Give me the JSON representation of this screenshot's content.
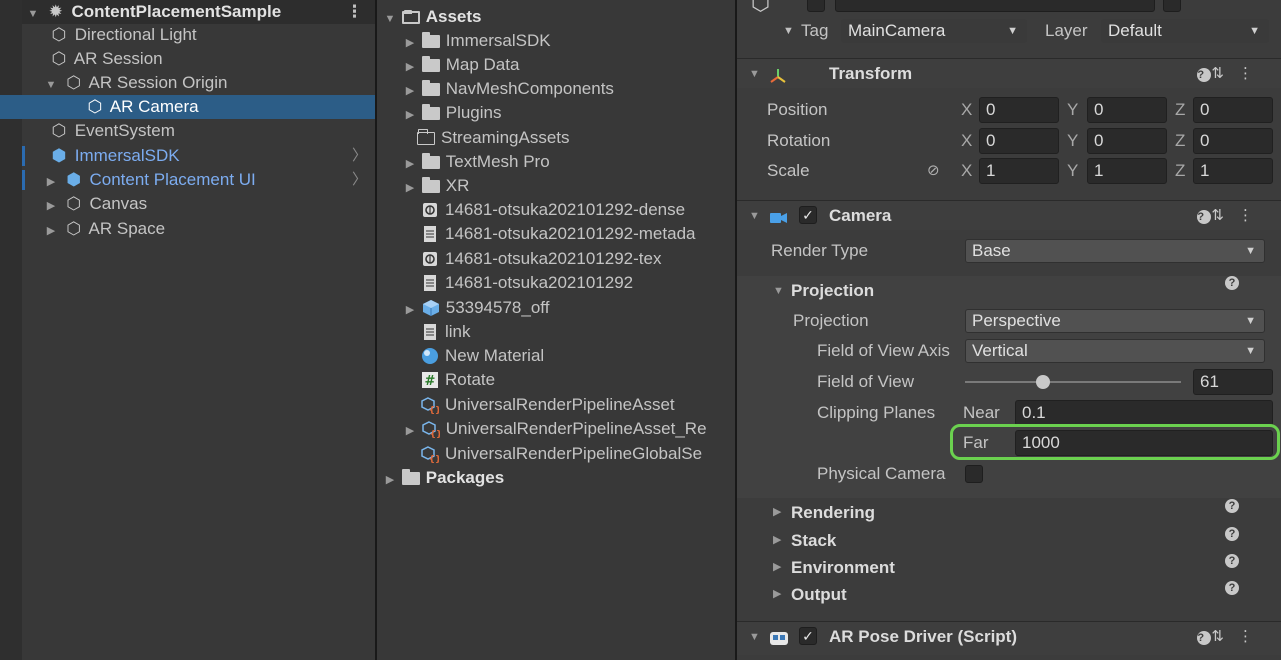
{
  "hierarchy": {
    "scene_name": "ContentPlacementSample",
    "items": [
      {
        "label": "Directional Light"
      },
      {
        "label": "AR Session"
      },
      {
        "label": "AR Session Origin"
      },
      {
        "label": "AR Camera"
      },
      {
        "label": "EventSystem"
      },
      {
        "label": "ImmersalSDK"
      },
      {
        "label": "Content Placement UI"
      },
      {
        "label": "Canvas"
      },
      {
        "label": "AR Space"
      }
    ]
  },
  "project": {
    "root": "Assets",
    "items": [
      {
        "label": "ImmersalSDK"
      },
      {
        "label": "Map Data"
      },
      {
        "label": "NavMeshComponents"
      },
      {
        "label": "Plugins"
      },
      {
        "label": "StreamingAssets"
      },
      {
        "label": "TextMesh Pro"
      },
      {
        "label": "XR"
      },
      {
        "label": "14681-otsuka202101292-dense"
      },
      {
        "label": "14681-otsuka202101292-metada"
      },
      {
        "label": "14681-otsuka202101292-tex"
      },
      {
        "label": "14681-otsuka202101292"
      },
      {
        "label": "53394578_off"
      },
      {
        "label": "link"
      },
      {
        "label": "New Material"
      },
      {
        "label": "Rotate"
      },
      {
        "label": "UniversalRenderPipelineAsset"
      },
      {
        "label": "UniversalRenderPipelineAsset_Re"
      },
      {
        "label": "UniversalRenderPipelineGlobalSe"
      }
    ],
    "packages": "Packages"
  },
  "inspector": {
    "tag_label": "Tag",
    "tag_value": "MainCamera",
    "layer_label": "Layer",
    "layer_value": "Default",
    "transform": {
      "title": "Transform",
      "position_label": "Position",
      "rotation_label": "Rotation",
      "scale_label": "Scale",
      "axis_x": "X",
      "axis_y": "Y",
      "axis_z": "Z",
      "position": [
        "0",
        "0",
        "0"
      ],
      "rotation": [
        "0",
        "0",
        "0"
      ],
      "scale": [
        "1",
        "1",
        "1"
      ]
    },
    "camera": {
      "title": "Camera",
      "render_type_label": "Render Type",
      "render_type_value": "Base",
      "projection_section": "Projection",
      "projection_label": "Projection",
      "projection_value": "Perspective",
      "fov_axis_label": "Field of View Axis",
      "fov_axis_value": "Vertical",
      "fov_label": "Field of View",
      "fov_value": "61",
      "fov_slider_fraction": 0.36,
      "clipping_label": "Clipping Planes",
      "near_label": "Near",
      "near_value": "0.1",
      "far_label": "Far",
      "far_value": "1000",
      "physical_camera_label": "Physical Camera",
      "sections": [
        "Rendering",
        "Stack",
        "Environment",
        "Output"
      ]
    },
    "pose_driver": {
      "title": "AR Pose Driver (Script)"
    },
    "highlight_color": "#6bd14f"
  }
}
